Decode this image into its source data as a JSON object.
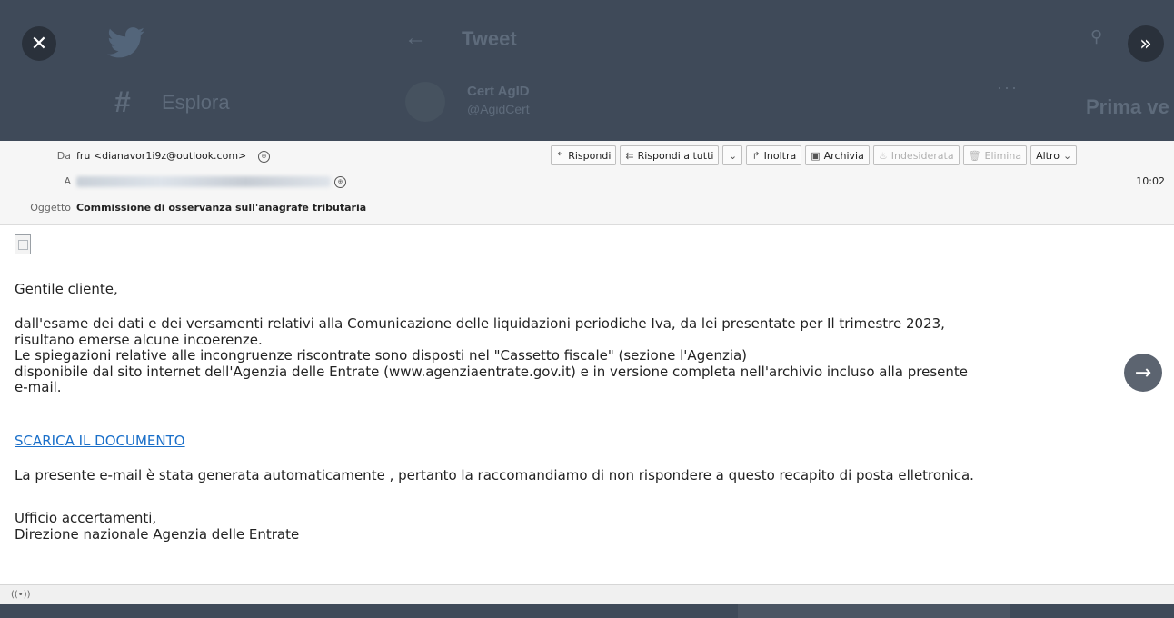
{
  "overlay": {
    "close_glyph": "✕",
    "expand_glyph": "»",
    "back_glyph": "←",
    "tweet_title": "Tweet",
    "explore_hash": "#",
    "explore_label": "Esplora",
    "account_name": "Cert AgID",
    "account_handle": "@AgidCert",
    "more_glyph": "···",
    "search_glyph": "⚲",
    "side_heading": "Prima ve"
  },
  "header": {
    "from_label": "Da",
    "from_value": "fru <dianavor1i9z@outlook.com>",
    "to_label": "A",
    "subject_label": "Oggetto",
    "subject_value": "Commissione di osservanza sull'anagrafe tributaria",
    "time": "10:02",
    "toolbar": {
      "reply": "Rispondi",
      "reply_all": "Rispondi a tutti",
      "forward": "Inoltra",
      "archive": "Archivia",
      "junk": "Indesiderata",
      "delete": "Elimina",
      "more": "Altro"
    }
  },
  "body": {
    "greeting": "Gentile cliente,",
    "para1_line1": "dall'esame dei dati e dei versamenti relativi alla Comunicazione delle liquidazioni periodiche Iva, da lei presentate per Il trimestre 2023,",
    "para1_line2": "risultano emerse alcune incoerenze.",
    "para1_line3": "Le spiegazioni relative alle incongruenze riscontrate sono disposti nel \"Cassetto fiscale\" (sezione l'Agenzia)",
    "para1_line4": "disponibile dal sito internet dell'Agenzia delle Entrate (www.agenziaentrate.gov.it) e in versione completa nell'archivio incluso alla presente",
    "para1_line5": "e-mail.",
    "link": "SCARICA IL DOCUMENTO",
    "para2": "La presente e-mail è stata generata automaticamente , pertanto la raccomandiamo di non rispondere a questo recapito di posta elletronica.",
    "sign_line1": "Ufficio accertamenti,",
    "sign_line2": "Direzione nazionale Agenzia delle Entrate",
    "next_glyph": "→"
  },
  "statusbar": {
    "activity_glyph": "((•))"
  }
}
